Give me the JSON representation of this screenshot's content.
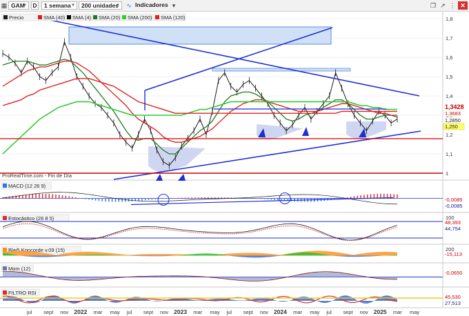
{
  "toolbar": {
    "instrument": "GAM",
    "timeframe": "1 semana",
    "units": "200 unidades",
    "indicators": "Indicadores",
    "mode_label": "D"
  },
  "colors": {
    "price": "#1a1a1a",
    "sma40": "#d81b1b",
    "sma4": "#000000",
    "sma20": "#1f7a1f",
    "sma200": "#33cc33",
    "sma120": "#e02020",
    "trendline": "#1f2fd6",
    "support": "#d00000"
  },
  "legend_main": [
    {
      "label": "Precio",
      "color": "#1a1a1a"
    },
    {
      "label": "SMA (40)",
      "color": "#d81b1b"
    },
    {
      "label": "SMA (4)",
      "color": "#000000"
    },
    {
      "label": "SMA (20)",
      "color": "#1f7a1f"
    },
    {
      "label": "SMA (200)",
      "color": "#33cc33"
    },
    {
      "label": "SMA (120)",
      "color": "#e02020"
    }
  ],
  "source_label": "ProRealTime.com - Fin de Día",
  "price_badges": [
    {
      "text": "1,3428",
      "value": 1.3428,
      "bg": "#ffffff",
      "fg": "#cc0000",
      "bold": true
    },
    {
      "text": "1,3683",
      "value": 1.3683,
      "bg": "#ffffff",
      "fg": "#cc0000",
      "bold": false
    },
    {
      "text": "1,2850",
      "value": 1.285,
      "bg": "#ffffff",
      "fg": "#1a1a1a",
      "bold": false
    },
    {
      "text": "1,250",
      "value": 1.25,
      "bg": "#ffff66",
      "fg": "#1a1a1a",
      "bold": false
    }
  ],
  "panels": [
    {
      "name": "macd",
      "label": "MACD (12 26 9)",
      "badges": [
        "-0,0085",
        "-0,0085"
      ]
    },
    {
      "name": "stochastic",
      "label": "Estocástico (26 8 5)",
      "ticks": [
        "100"
      ],
      "badges": [
        "48,393",
        "44,754"
      ]
    },
    {
      "name": "blai5",
      "label": "Blai5 Koncorde v.09 (15)",
      "ticks": [
        "200"
      ],
      "badges": [
        "-15,113"
      ]
    },
    {
      "name": "momentum",
      "label": "Mom (12)",
      "badges": [
        "-0,0650"
      ]
    },
    {
      "name": "filtro-rsi",
      "label": "FILTRO RSI",
      "badges": [
        "45,530",
        "27,513"
      ]
    }
  ],
  "chart_data": {
    "type": "line",
    "y_axis_ticks": [
      "1,8",
      "1,7",
      "1,6",
      "1,5",
      "1,4",
      "1,3",
      "1,2",
      "1,1",
      "1"
    ],
    "ylim": [
      0.98,
      1.82
    ],
    "x_axis_ticks": [
      "jul",
      "sept",
      "nov",
      "2022",
      "mar",
      "may",
      "jul",
      "sept",
      "nov",
      "2023",
      "mar",
      "may",
      "jul",
      "sept",
      "nov",
      "2024",
      "mar",
      "may",
      "jul",
      "sept",
      "nov",
      "2025",
      "mar",
      "may"
    ],
    "x_year_ticks": [
      "2022",
      "2023",
      "2024",
      "2025"
    ],
    "series": [
      {
        "name": "Precio",
        "values": [
          1.62,
          1.6,
          1.57,
          1.52,
          1.58,
          1.55,
          1.5,
          1.48,
          1.52,
          1.55,
          1.68,
          1.6,
          1.5,
          1.45,
          1.4,
          1.36,
          1.34,
          1.3,
          1.26,
          1.2,
          1.16,
          1.13,
          1.2,
          1.28,
          1.22,
          1.12,
          1.06,
          1.04,
          1.08,
          1.14,
          1.18,
          1.22,
          1.28,
          1.2,
          1.32,
          1.48,
          1.52,
          1.45,
          1.42,
          1.46,
          1.48,
          1.44,
          1.4,
          1.36,
          1.3,
          1.26,
          1.22,
          1.25,
          1.3,
          1.34,
          1.28,
          1.32,
          1.36,
          1.4,
          1.52,
          1.44,
          1.36,
          1.3,
          1.26,
          1.22,
          1.27,
          1.32,
          1.3,
          1.26,
          1.28
        ]
      },
      {
        "name": "SMA (20)",
        "values": [
          1.56,
          1.57,
          1.58,
          1.58,
          1.58,
          1.57,
          1.56,
          1.56,
          1.57,
          1.58,
          1.59,
          1.58,
          1.55,
          1.52,
          1.48,
          1.44,
          1.4,
          1.36,
          1.32,
          1.27,
          1.22,
          1.18,
          1.17,
          1.18,
          1.18,
          1.15,
          1.12,
          1.1,
          1.1,
          1.13,
          1.16,
          1.19,
          1.22,
          1.24,
          1.27,
          1.32,
          1.37,
          1.4,
          1.41,
          1.42,
          1.42,
          1.41,
          1.39,
          1.37,
          1.34,
          1.31,
          1.28,
          1.27,
          1.28,
          1.3,
          1.31,
          1.32,
          1.34,
          1.36,
          1.38,
          1.38,
          1.36,
          1.33,
          1.3,
          1.28,
          1.28,
          1.29,
          1.3,
          1.3,
          1.29
        ]
      },
      {
        "name": "SMA (40)",
        "values": [
          1.45,
          1.47,
          1.49,
          1.51,
          1.53,
          1.54,
          1.55,
          1.55,
          1.56,
          1.57,
          1.58,
          1.58,
          1.57,
          1.55,
          1.53,
          1.5,
          1.47,
          1.44,
          1.41,
          1.38,
          1.35,
          1.31,
          1.28,
          1.26,
          1.24,
          1.22,
          1.19,
          1.17,
          1.16,
          1.16,
          1.17,
          1.18,
          1.19,
          1.21,
          1.23,
          1.26,
          1.29,
          1.32,
          1.34,
          1.36,
          1.37,
          1.38,
          1.38,
          1.37,
          1.36,
          1.35,
          1.34,
          1.33,
          1.32,
          1.32,
          1.32,
          1.32,
          1.33,
          1.34,
          1.35,
          1.36,
          1.36,
          1.35,
          1.34,
          1.33,
          1.32,
          1.31,
          1.31,
          1.3,
          1.3
        ]
      },
      {
        "name": "SMA (200)",
        "values": [
          1.1,
          1.13,
          1.16,
          1.19,
          1.22,
          1.25,
          1.28,
          1.3,
          1.32,
          1.34,
          1.35,
          1.36,
          1.37,
          1.37,
          1.37,
          1.36,
          1.35,
          1.34,
          1.33,
          1.32,
          1.31,
          1.3,
          1.3,
          1.3,
          1.3,
          1.3,
          1.3,
          1.3,
          1.3,
          1.3,
          1.31,
          1.32,
          1.33,
          1.33,
          1.34,
          1.35,
          1.36,
          1.37,
          1.37,
          1.37,
          1.37,
          1.37,
          1.37,
          1.37,
          1.37,
          1.37,
          1.37,
          1.37,
          1.37,
          1.37,
          1.37,
          1.37,
          1.37,
          1.37,
          1.37,
          1.37,
          1.37,
          1.36,
          1.35,
          1.35,
          1.34,
          1.34,
          1.33,
          1.33,
          1.33
        ]
      },
      {
        "name": "SMA (120)",
        "values": [
          1.35,
          1.36,
          1.37,
          1.38,
          1.4,
          1.41,
          1.43,
          1.44,
          1.45,
          1.46,
          1.47,
          1.48,
          1.49,
          1.49,
          1.49,
          1.48,
          1.47,
          1.46,
          1.45,
          1.43,
          1.41,
          1.39,
          1.37,
          1.36,
          1.35,
          1.34,
          1.33,
          1.32,
          1.31,
          1.31,
          1.31,
          1.31,
          1.31,
          1.31,
          1.31,
          1.31,
          1.31,
          1.31,
          1.31,
          1.31,
          1.31,
          1.31,
          1.31,
          1.31,
          1.31,
          1.31,
          1.31,
          1.31,
          1.31,
          1.31,
          1.31,
          1.31,
          1.31,
          1.31,
          1.31,
          1.32,
          1.32,
          1.32,
          1.32,
          1.32,
          1.32,
          1.32,
          1.32,
          1.32,
          1.32
        ]
      }
    ],
    "support_line": 1.19,
    "bottom_line": 1.0
  }
}
